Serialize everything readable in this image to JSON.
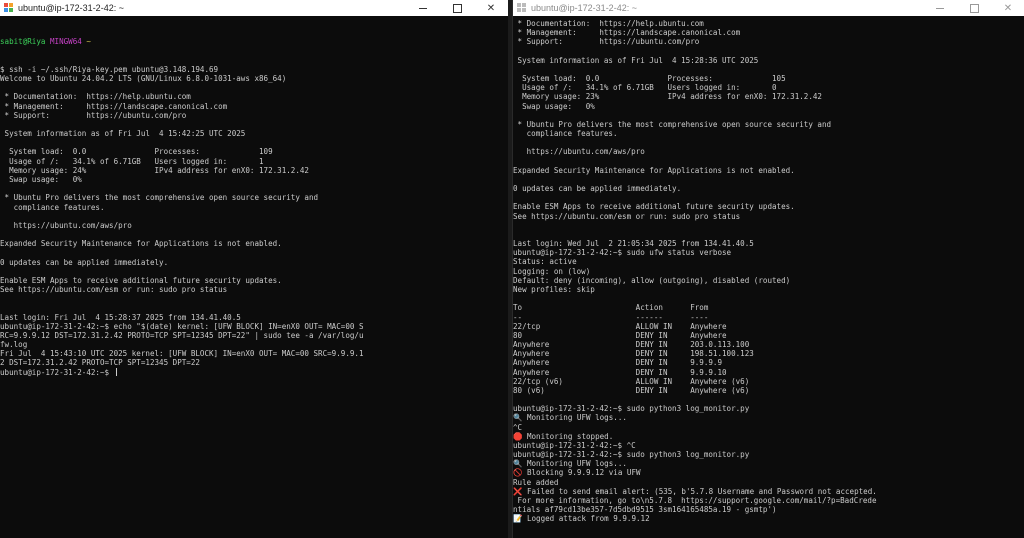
{
  "left_window": {
    "title": "ubuntu@ip-172-31-2-42: ~",
    "prompt_header": {
      "user": "sabit@Riya",
      "host": "MINGW64",
      "path": "~"
    },
    "lines": [
      "$ ssh -i ~/.ssh/Riya-key.pem ubuntu@3.148.194.69",
      "Welcome to Ubuntu 24.04.2 LTS (GNU/Linux 6.8.0-1031-aws x86_64)",
      "",
      " * Documentation:  https://help.ubuntu.com",
      " * Management:     https://landscape.canonical.com",
      " * Support:        https://ubuntu.com/pro",
      "",
      " System information as of Fri Jul  4 15:42:25 UTC 2025",
      "",
      "  System load:  0.0               Processes:             109",
      "  Usage of /:   34.1% of 6.71GB   Users logged in:       1",
      "  Memory usage: 24%               IPv4 address for enX0: 172.31.2.42",
      "  Swap usage:   0%",
      "",
      " * Ubuntu Pro delivers the most comprehensive open source security and",
      "   compliance features.",
      "",
      "   https://ubuntu.com/aws/pro",
      "",
      "Expanded Security Maintenance for Applications is not enabled.",
      "",
      "0 updates can be applied immediately.",
      "",
      "Enable ESM Apps to receive additional future security updates.",
      "See https://ubuntu.com/esm or run: sudo pro status",
      "",
      "",
      "Last login: Fri Jul  4 15:28:37 2025 from 134.41.40.5",
      "ubuntu@ip-172-31-2-42:~$ echo \"$(date) kernel: [UFW BLOCK] IN=enX0 OUT= MAC=00 S",
      "RC=9.9.9.12 DST=172.31.2.42 PROTO=TCP SPT=12345 DPT=22\" | sudo tee -a /var/log/u",
      "fw.log",
      "Fri Jul  4 15:43:10 UTC 2025 kernel: [UFW BLOCK] IN=enX0 OUT= MAC=00 SRC=9.9.9.1",
      "2 DST=172.31.2.42 PROTO=TCP SPT=12345 DPT=22",
      "ubuntu@ip-172-31-2-42:~$ |"
    ]
  },
  "right_window": {
    "title": "ubuntu@ip-172-31-2-42: ~",
    "lines": [
      " * Documentation:  https://help.ubuntu.com",
      " * Management:     https://landscape.canonical.com",
      " * Support:        https://ubuntu.com/pro",
      "",
      " System information as of Fri Jul  4 15:28:36 UTC 2025",
      "",
      "  System load:  0.0               Processes:             105",
      "  Usage of /:   34.1% of 6.71GB   Users logged in:       0",
      "  Memory usage: 23%               IPv4 address for enX0: 172.31.2.42",
      "  Swap usage:   0%",
      "",
      " * Ubuntu Pro delivers the most comprehensive open source security and",
      "   compliance features.",
      "",
      "   https://ubuntu.com/aws/pro",
      "",
      "Expanded Security Maintenance for Applications is not enabled.",
      "",
      "0 updates can be applied immediately.",
      "",
      "Enable ESM Apps to receive additional future security updates.",
      "See https://ubuntu.com/esm or run: sudo pro status",
      "",
      "",
      "Last login: Wed Jul  2 21:05:34 2025 from 134.41.40.5",
      "ubuntu@ip-172-31-2-42:~$ sudo ufw status verbose",
      "Status: active",
      "Logging: on (low)",
      "Default: deny (incoming), allow (outgoing), disabled (routed)",
      "New profiles: skip",
      "",
      "To                         Action      From",
      "--                         ------      ----",
      "22/tcp                     ALLOW IN    Anywhere",
      "80                         DENY IN     Anywhere",
      "Anywhere                   DENY IN     203.0.113.100",
      "Anywhere                   DENY IN     198.51.100.123",
      "Anywhere                   DENY IN     9.9.9.9",
      "Anywhere                   DENY IN     9.9.9.10",
      "22/tcp (v6)                ALLOW IN    Anywhere (v6)",
      "80 (v6)                    DENY IN     Anywhere (v6)",
      "",
      "ubuntu@ip-172-31-2-42:~$ sudo python3 log_monitor.py",
      "🔍 Monitoring UFW logs...",
      "^C",
      "🛑 Monitoring stopped.",
      "ubuntu@ip-172-31-2-42:~$ ^C",
      "ubuntu@ip-172-31-2-42:~$ sudo python3 log_monitor.py",
      "🔍 Monitoring UFW logs...",
      "🚫 Blocking 9.9.9.12 via UFW",
      "Rule added",
      "❌ Failed to send email alert: (535, b'5.7.8 Username and Password not accepted.",
      " For more information, go to\\n5.7.8  https://support.google.com/mail/?p=BadCrede",
      "ntials af79cd13be357-7d5dbd9515 3sm164165485a.19 - gsmtp')",
      "📝 Logged attack from 9.9.9.12"
    ]
  },
  "controls": {
    "minimize": "—",
    "maximize": "☐",
    "close": "✕"
  },
  "colors": {
    "background": "#0c0c0c",
    "text": "#cccccc",
    "user_green": "#3cd05a",
    "host_magenta": "#c742c7",
    "path_yellow": "#d0c24a"
  }
}
